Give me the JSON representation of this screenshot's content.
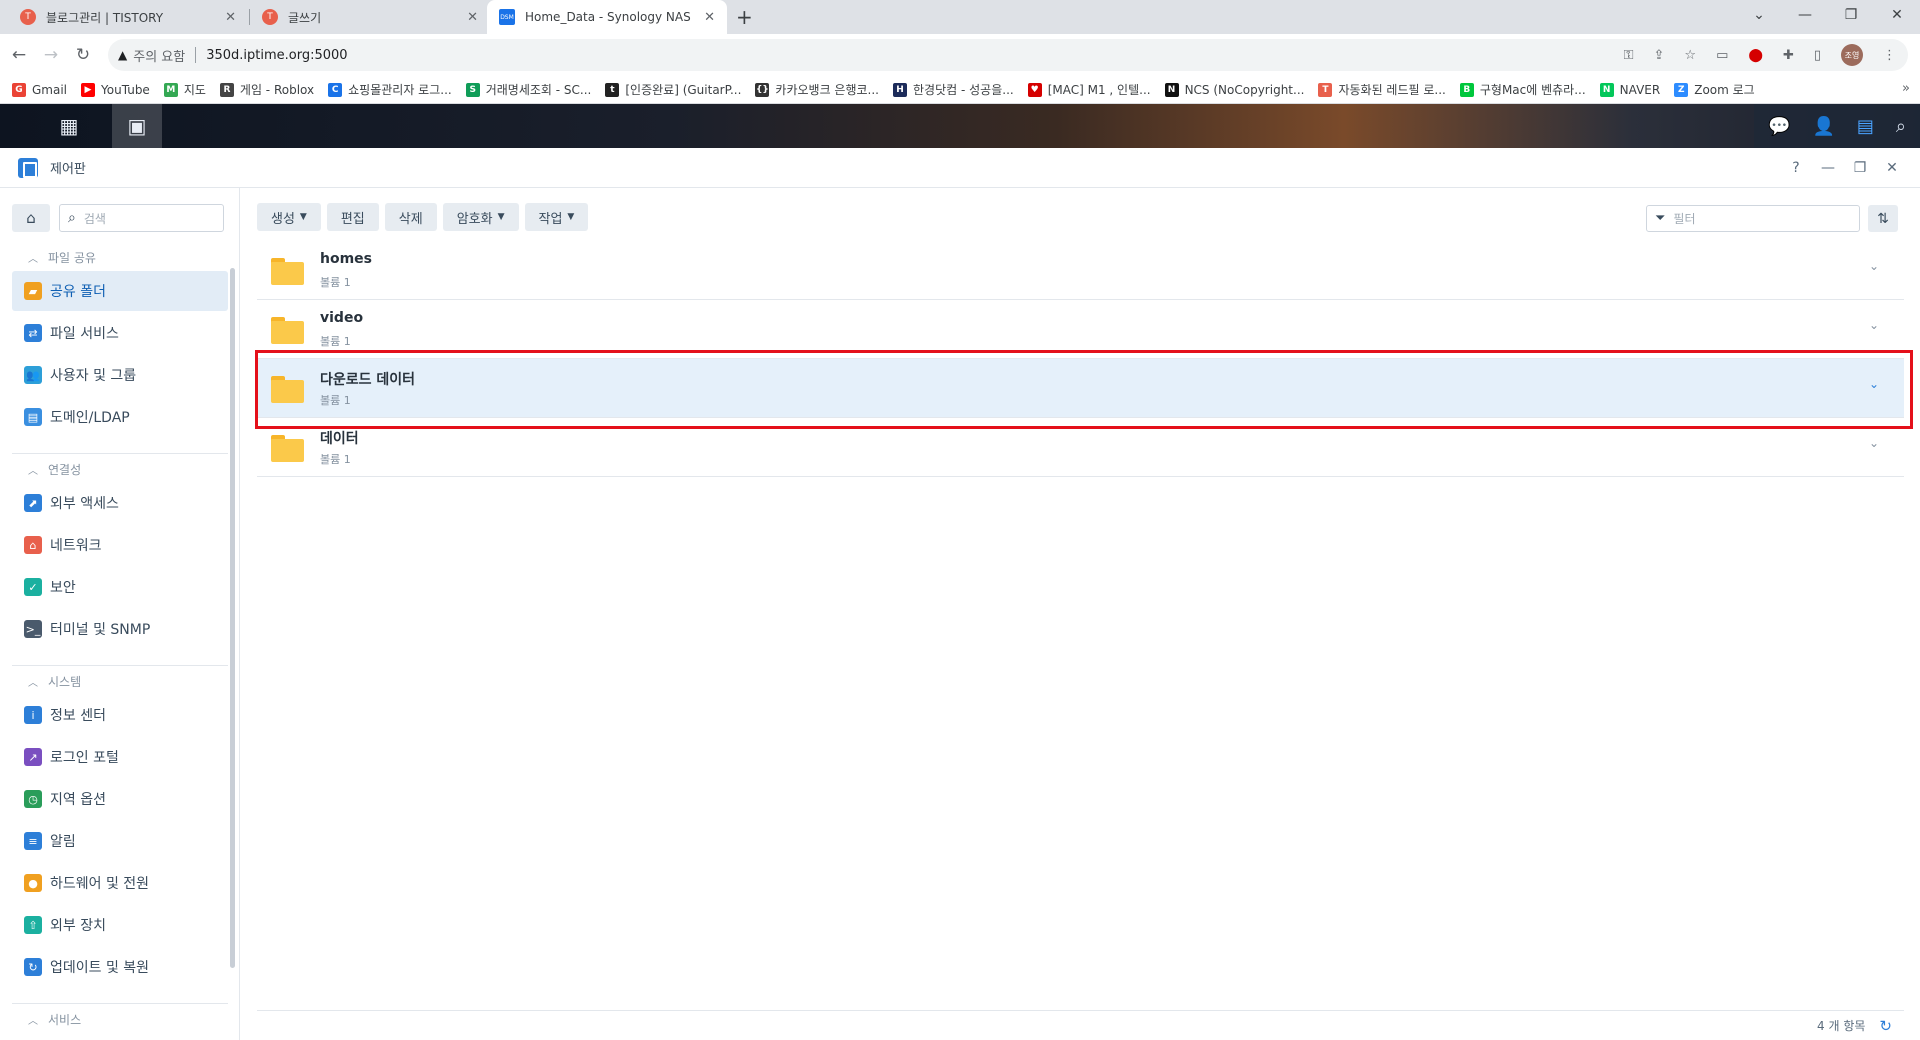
{
  "browser": {
    "tabs": [
      {
        "title": "블로그관리 | TISTORY",
        "favicon": "T",
        "active": false
      },
      {
        "title": "글쓰기",
        "favicon": "T",
        "active": false
      },
      {
        "title": "Home_Data - Synology NAS",
        "favicon": "DSM",
        "active": true
      }
    ],
    "new_tab_icon": "+",
    "address": {
      "warning": "주의 요함",
      "url": "350d.iptime.org:5000"
    },
    "profile_initial": "조영",
    "bookmarks": [
      {
        "label": "Gmail",
        "color": "#ea4335",
        "icon": "G"
      },
      {
        "label": "YouTube",
        "color": "#ff0000",
        "icon": "▶"
      },
      {
        "label": "지도",
        "color": "#34a853",
        "icon": "M"
      },
      {
        "label": "게임 - Roblox",
        "color": "#444444",
        "icon": "R"
      },
      {
        "label": "쇼핑몰관리자 로그...",
        "color": "#1a73e8",
        "icon": "C"
      },
      {
        "label": "거래명세조회 - SC...",
        "color": "#0f9d58",
        "icon": "S"
      },
      {
        "label": "[인증완료] (GuitarP...",
        "color": "#222222",
        "icon": "t"
      },
      {
        "label": "카카오뱅크 은행코...",
        "color": "#333333",
        "icon": "{}"
      },
      {
        "label": "한경닷컴 - 성공을...",
        "color": "#1c2b5a",
        "icon": "H"
      },
      {
        "label": "[MAC] M1 , 인텔...",
        "color": "#d50000",
        "icon": "♥"
      },
      {
        "label": "NCS (NoCopyright...",
        "color": "#111111",
        "icon": "N"
      },
      {
        "label": "자동화된 레드필 로...",
        "color": "#e8604c",
        "icon": "T"
      },
      {
        "label": "구형Mac에 벤츄라...",
        "color": "#00c73c",
        "icon": "B"
      },
      {
        "label": "NAVER",
        "color": "#03c75a",
        "icon": "N"
      },
      {
        "label": "Zoom 로그",
        "color": "#2d8cff",
        "icon": "Z"
      }
    ]
  },
  "app": {
    "title": "제어판",
    "sidebar": {
      "search_placeholder": "검색",
      "sections": [
        {
          "label": "파일 공유",
          "items": [
            {
              "label": "공유 폴더",
              "icon": "shared-folder-icon",
              "color": "#f0a020",
              "selected": true
            },
            {
              "label": "파일 서비스",
              "icon": "file-services-icon",
              "color": "#2d7fd8",
              "selected": false
            },
            {
              "label": "사용자 및 그룹",
              "icon": "user-group-icon",
              "color": "#2d9fd8",
              "selected": false
            },
            {
              "label": "도메인/LDAP",
              "icon": "domain-ldap-icon",
              "color": "#3a8fe0",
              "selected": false
            }
          ]
        },
        {
          "label": "연결성",
          "items": [
            {
              "label": "외부 액세스",
              "icon": "external-access-icon",
              "color": "#2d7fd8",
              "selected": false
            },
            {
              "label": "네트워크",
              "icon": "network-icon",
              "color": "#e8604c",
              "selected": false
            },
            {
              "label": "보안",
              "icon": "security-shield-icon",
              "color": "#1bb0a0",
              "selected": false
            },
            {
              "label": "터미널 및 SNMP",
              "icon": "terminal-icon",
              "color": "#4a5a6c",
              "selected": false
            }
          ]
        },
        {
          "label": "시스템",
          "items": [
            {
              "label": "정보 센터",
              "icon": "info-center-icon",
              "color": "#2d7fd8",
              "selected": false
            },
            {
              "label": "로그인 포털",
              "icon": "login-portal-icon",
              "color": "#7a4fc0",
              "selected": false
            },
            {
              "label": "지역 옵션",
              "icon": "regional-options-icon",
              "color": "#2a9d5a",
              "selected": false
            },
            {
              "label": "알림",
              "icon": "notification-icon",
              "color": "#2d7fd8",
              "selected": false
            },
            {
              "label": "하드웨어 및 전원",
              "icon": "hardware-power-icon",
              "color": "#f0a020",
              "selected": false
            },
            {
              "label": "외부 장치",
              "icon": "external-devices-icon",
              "color": "#1bb0a0",
              "selected": false
            },
            {
              "label": "업데이트 및 복원",
              "icon": "update-restore-icon",
              "color": "#2d7fd8",
              "selected": false
            }
          ]
        },
        {
          "label": "서비스",
          "items": []
        }
      ]
    },
    "toolbar": {
      "buttons": [
        {
          "label": "생성",
          "dropdown": true
        },
        {
          "label": "편집",
          "dropdown": false
        },
        {
          "label": "삭제",
          "dropdown": false
        },
        {
          "label": "암호화",
          "dropdown": true
        },
        {
          "label": "작업",
          "dropdown": true
        }
      ],
      "filter_placeholder": "필터"
    },
    "folders": [
      {
        "name": "homes",
        "volume": "볼륨 1",
        "highlighted": false
      },
      {
        "name": "video",
        "volume": "볼륨 1",
        "highlighted": false
      },
      {
        "name": "다운로드 데이터",
        "volume": "볼륨 1",
        "highlighted": true
      },
      {
        "name": "데이터",
        "volume": "볼륨 1",
        "highlighted": false
      }
    ],
    "footer": {
      "count": "4 개 항목"
    }
  },
  "colors": {
    "accent": "#2d7fd8",
    "highlight_border": "#e4101a",
    "selected_row": "#e5f0fa"
  }
}
